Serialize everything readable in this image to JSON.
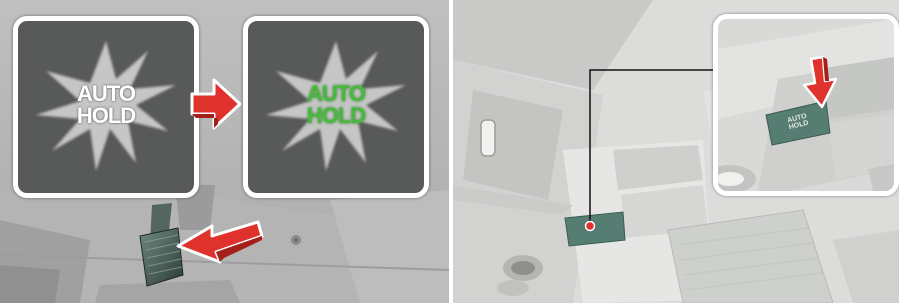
{
  "indicator_off": {
    "line1": "AUTO",
    "line2": "HOLD",
    "color": "#ffffff"
  },
  "indicator_on": {
    "line1": "AUTO",
    "line2": "HOLD",
    "color": "#49b83e"
  },
  "console_switch": {
    "line1": "AUTO",
    "line2": "HOLD"
  },
  "colors": {
    "arrow_red": "#e0322c",
    "switch_green": "#557d72",
    "indicator_bg": "#585a59"
  },
  "icons": [
    "right-arrow-icon",
    "press-arrow-icon",
    "push-down-arrow-icon",
    "brake-pedal-icon",
    "switch-location-dot-icon"
  ]
}
